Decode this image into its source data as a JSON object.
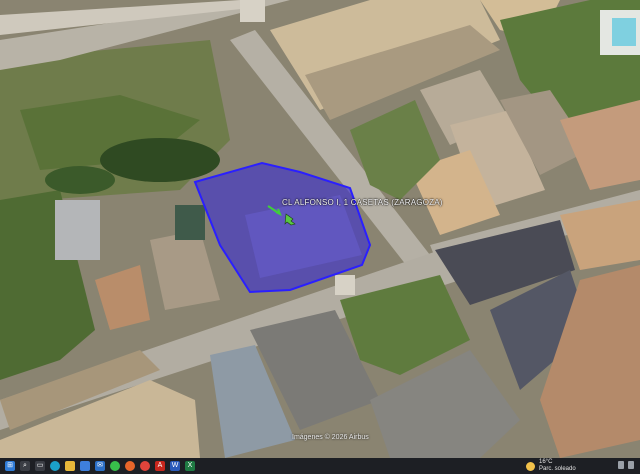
{
  "map": {
    "parcel_label": "CL ALFONSO I, 1 CASETAS (ZARAGOZA)",
    "attribution": "Imágenes © 2026 Airbus"
  },
  "taskbar": {
    "icons": [
      "windows-start-icon",
      "search-icon",
      "task-view-icon",
      "edge-icon",
      "file-explorer-icon",
      "store-icon",
      "mail-icon",
      "whatsapp-icon",
      "firefox-icon",
      "chrome-icon",
      "acrobat-icon",
      "word-icon",
      "excel-icon"
    ],
    "weather_temp": "16°C",
    "weather_desc": "Parc. soleado"
  },
  "colors": {
    "parcel_fill": "#3b2fd0",
    "parcel_stroke": "#2a1fff",
    "taskbar": "#1d1f24"
  }
}
